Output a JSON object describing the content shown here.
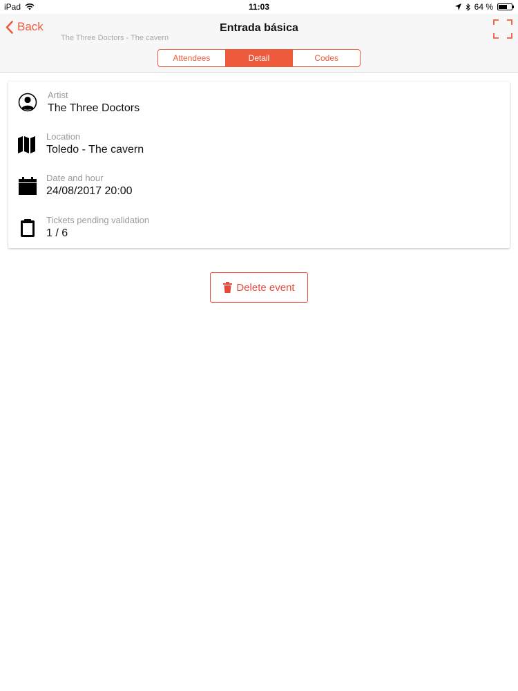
{
  "status_bar": {
    "device": "iPad",
    "time": "11:03",
    "battery": "64 %",
    "battery_level": 0.64
  },
  "nav": {
    "back_label": "Back",
    "title": "Entrada básica",
    "subtitle": "The Three Doctors - The cavern"
  },
  "tabs": [
    {
      "label": "Attendees",
      "active": false
    },
    {
      "label": "Detail",
      "active": true
    },
    {
      "label": "Codes",
      "active": false
    }
  ],
  "details": [
    {
      "icon": "person-icon",
      "label": "Artist",
      "value": "The Three Doctors"
    },
    {
      "icon": "map-icon",
      "label": "Location",
      "value": "Toledo - The cavern"
    },
    {
      "icon": "calendar-icon",
      "label": "Date and hour",
      "value": "24/08/2017 20:00"
    },
    {
      "icon": "clipboard-icon",
      "label": "Tickets pending validation",
      "value": "1 / 6"
    }
  ],
  "actions": {
    "delete_label": "Delete event"
  },
  "colors": {
    "accent": "#ee5a3c",
    "danger": "#e8493d"
  }
}
